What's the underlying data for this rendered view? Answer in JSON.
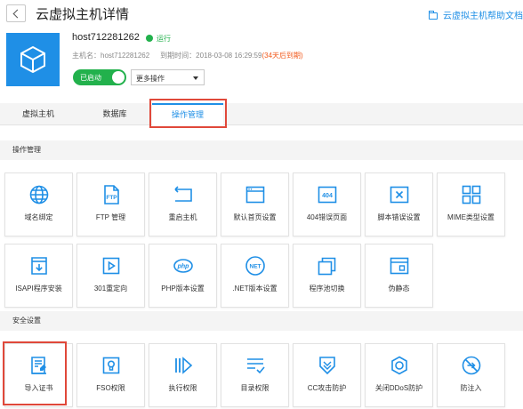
{
  "header": {
    "title": "云虚拟主机详情",
    "help_link": "云虚拟主机帮助文档"
  },
  "host": {
    "name": "host712281262",
    "status": "运行",
    "meta_host_label": "主机名：",
    "meta_host_value": "host712281262",
    "meta_expire_label": "到期时间：",
    "meta_expire_value": "2018-03-08 16:29:59",
    "meta_expire_warning": "(34天后到期)"
  },
  "controls": {
    "toggle_label": "已启动",
    "more_label": "更多操作"
  },
  "tabs": [
    "虚拟主机",
    "数据库",
    "操作管理"
  ],
  "active_tab": 2,
  "sections": {
    "operations": "操作管理",
    "security": "安全设置"
  },
  "operations": [
    {
      "label": "域名绑定",
      "icon": "globe-icon"
    },
    {
      "label": "FTP 管理",
      "icon": "ftp-icon"
    },
    {
      "label": "重启主机",
      "icon": "restart-icon"
    },
    {
      "label": "默认首页设置",
      "icon": "homepage-icon"
    },
    {
      "label": "404错误页面",
      "icon": "error-404-icon"
    },
    {
      "label": "脚本错误设置",
      "icon": "script-error-icon"
    },
    {
      "label": "MIME类型设置",
      "icon": "mime-grid-icon"
    },
    {
      "label": "ISAPI程序安装",
      "icon": "install-icon"
    },
    {
      "label": "301重定向",
      "icon": "redirect-icon"
    },
    {
      "label": "PHP版本设置",
      "icon": "php-icon"
    },
    {
      "label": ".NET版本设置",
      "icon": "dotnet-icon"
    },
    {
      "label": "程序池切换",
      "icon": "pool-switch-icon"
    },
    {
      "label": "伪静态",
      "icon": "rewrite-icon"
    }
  ],
  "security": [
    {
      "label": "导入证书",
      "icon": "certificate-icon"
    },
    {
      "label": "FSO权限",
      "icon": "fso-icon"
    },
    {
      "label": "执行权限",
      "icon": "execute-icon"
    },
    {
      "label": "目录权限",
      "icon": "directory-icon"
    },
    {
      "label": "CC攻击防护",
      "icon": "cc-shield-icon"
    },
    {
      "label": "关闭DDoS防护",
      "icon": "ddos-icon"
    },
    {
      "label": "防注入",
      "icon": "anti-injection-icon"
    }
  ],
  "icon_svgs": {
    "globe-icon": "<circle cx='12' cy='12' r='9.5' fill='none' stroke='#1f8fe6' stroke-width='1.6'/><ellipse cx='12' cy='12' rx='4' ry='9.5' fill='none' stroke='#1f8fe6' stroke-width='1.6'/><line x1='2.5' y1='12' x2='21.5' y2='12' stroke='#1f8fe6' stroke-width='1.6'/><path d='M4 7h16M4 17h16' stroke='#1f8fe6' stroke-width='1.4'/>",
    "ftp-icon": "<path d='M5 2h10l5 5v15H5z' fill='none' stroke='#1f8fe6' stroke-width='1.6'/><path d='M15 2v5h5' fill='none' stroke='#1f8fe6' stroke-width='1.6'/><text x='12.5' y='17' text-anchor='middle' font-size='6.5' font-weight='bold' fill='#1f8fe6' font-family='Liberation Sans, sans-serif'>FTP</text>",
    "restart-icon": "<path d='M3 6h18v13H3' fill='none' stroke='#1f8fe6' stroke-width='1.6'/><path d='M3 6L6 3M3 6L6 9' fill='none' stroke='#1f8fe6' stroke-width='1.6'/>",
    "homepage-icon": "<rect x='2.5' y='3.5' width='19' height='17' fill='none' stroke='#1f8fe6' stroke-width='1.6'/><line x1='2.5' y1='8' x2='21.5' y2='8' stroke='#1f8fe6' stroke-width='1.6'/><circle cx='5' cy='5.8' r='0.8' fill='#1f8fe6'/><circle cx='7.5' cy='5.8' r='0.8' fill='#1f8fe6'/>",
    "error-404-icon": "<rect x='2.5' y='3.5' width='19' height='17' fill='none' stroke='#1f8fe6' stroke-width='1.6'/><text x='12' y='15' text-anchor='middle' font-size='7' font-weight='bold' fill='#1f8fe6' font-family='Liberation Sans, sans-serif'>404</text>",
    "script-error-icon": "<rect x='2.5' y='3.5' width='19' height='17' fill='none' stroke='#1f8fe6' stroke-width='1.6'/><path d='M8.5 8.5l7 7M15.5 8.5l-7 7' stroke='#1f8fe6' stroke-width='1.6'/>",
    "mime-grid-icon": "<rect x='2.5' y='2.5' width='8' height='8' fill='none' stroke='#1f8fe6' stroke-width='1.6'/><rect x='13.5' y='2.5' width='8' height='8' fill='none' stroke='#1f8fe6' stroke-width='1.6'/><rect x='2.5' y='13.5' width='8' height='8' fill='none' stroke='#1f8fe6' stroke-width='1.6'/><rect x='13.5' y='13.5' width='8' height='8' fill='none' stroke='#1f8fe6' stroke-width='1.6'/>",
    "install-icon": "<path d='M4 3h16v18H4z' fill='none' stroke='#1f8fe6' stroke-width='1.6'/><path d='M4 7h16' stroke='#1f8fe6' stroke-width='1.6'/><path d='M12 10v7M8.8 13.8L12 17l3.2-3.2' fill='none' stroke='#1f8fe6' stroke-width='1.6'/>",
    "redirect-icon": "<rect x='3.5' y='3.5' width='17' height='17' fill='none' stroke='#1f8fe6' stroke-width='1.6'/><path d='M9.5 8l6 4-6 4z' fill='none' stroke='#1f8fe6' stroke-width='1.6'/>",
    "php-icon": "<ellipse cx='12' cy='12' rx='10' ry='7' fill='none' stroke='#1f8fe6' stroke-width='1.6'/><text x='12' y='14.7' text-anchor='middle' font-size='7' font-style='italic' font-weight='bold' fill='#1f8fe6' font-family='Liberation Sans, sans-serif'>php</text>",
    "dotnet-icon": "<circle cx='12' cy='12' r='10' fill='none' stroke='#1f8fe6' stroke-width='1.6'/><text x='12' y='14.6' text-anchor='middle' font-size='6.5' font-weight='bold' fill='#1f8fe6' font-family='Liberation Sans, sans-serif'>NET</text>",
    "pool-switch-icon": "<rect x='2.5' y='7.5' width='14' height='14' fill='none' stroke='#1f8fe6' stroke-width='1.6'/><path d='M6.5 7.5V3.5h14v14h-4' fill='none' stroke='#1f8fe6' stroke-width='1.6'/>",
    "rewrite-icon": "<rect x='2.5' y='3.5' width='19' height='17' fill='none' stroke='#1f8fe6' stroke-width='1.6'/><path d='M2.5 8h19' stroke='#1f8fe6' stroke-width='1.6'/><rect x='12.5' y='12' width='5' height='5' fill='none' stroke='#1f8fe6' stroke-width='1.4'/>",
    "certificate-icon": "<path d='M4 3h14v18H4z' fill='none' stroke='#1f8fe6' stroke-width='1.6'/><path d='M7 7h8M7 10h8M7 13h4' stroke='#1f8fe6' stroke-width='1.5'/><path d='M13 15l4-4 3 3-4 4h-3z' fill='#1f8fe6'/><path d='M4 21h16' stroke='#1f8fe6' stroke-width='1.6'/>",
    "fso-icon": "<rect x='3.5' y='3.5' width='17' height='17' fill='none' stroke='#1f8fe6' stroke-width='1.6'/><circle cx='12' cy='10.5' r='3.2' fill='none' stroke='#1f8fe6' stroke-width='1.6'/><path d='M10.5 13.5v3.5h3v-3.5' fill='none' stroke='#1f8fe6' stroke-width='1.5'/>",
    "execute-icon": "<path d='M4 4v16M8 4v16' stroke='#1f8fe6' stroke-width='1.8'/><path d='M12 4l9 8-9 8z' fill='none' stroke='#1f8fe6' stroke-width='1.6'/>",
    "directory-icon": "<path d='M3 5h18M3 10h18M3 15h9' stroke='#1f8fe6' stroke-width='1.6'/><path d='M14 17l3 3 5-6' fill='none' stroke='#1f8fe6' stroke-width='1.6'/>",
    "cc-shield-icon": "<path d='M4 3h16v10l-8 8-8-8z' fill='none' stroke='#1f8fe6' stroke-width='1.6'/><path d='M8 8l4 4 4-4M8 12l4 4 4-4' fill='none' stroke='#1f8fe6' stroke-width='1.4'/>",
    "ddos-icon": "<path d='M12 2.5l8 4.5v10l-8 4.5-8-4.5V7z' fill='none' stroke='#1f8fe6' stroke-width='1.6'/><circle cx='12' cy='12' r='4' fill='none' stroke='#1f8fe6' stroke-width='1.6'/>",
    "anti-injection-icon": "<circle cx='12' cy='12' r='9.5' fill='none' stroke='#1f8fe6' stroke-width='1.6'/><path d='M5.5 5.5l13 13' stroke='#1f8fe6' stroke-width='1.6'/><path d='M7.5 12h8M12.5 9l3 3-3 3' fill='none' stroke='#1f8fe6' stroke-width='1.5'/>"
  }
}
